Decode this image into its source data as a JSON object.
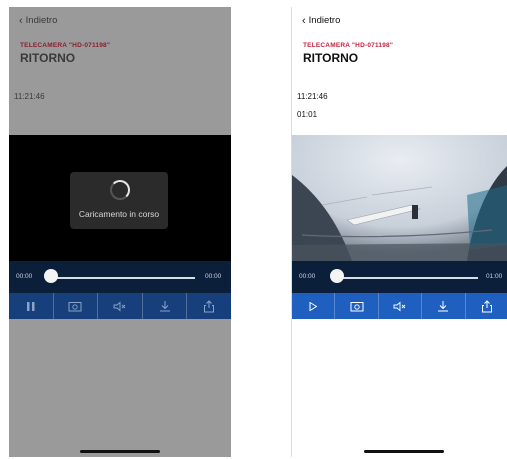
{
  "left": {
    "back_label": "Indietro",
    "camera_label": "TELECAMERA \"HD-071198\"",
    "title": "RITORNO",
    "time": "11:21:46",
    "loading_text": "Caricamento in corso",
    "seek_start": "00:00",
    "seek_end": "00:00",
    "progress": 0,
    "controls": [
      "pause-icon",
      "snapshot-icon",
      "speaker-muted-icon",
      "download-icon",
      "share-icon"
    ]
  },
  "right": {
    "back_label": "Indietro",
    "camera_label": "TELECAMERA \"HD-071198\"",
    "title": "RITORNO",
    "time": "11:21:46",
    "duration": "01:01",
    "seek_start": "00:00",
    "seek_end": "01:00",
    "progress": 0,
    "controls": [
      "play-icon",
      "snapshot-icon",
      "speaker-muted-icon",
      "download-icon",
      "share-icon"
    ]
  },
  "colors": {
    "accent_blue": "#1f5fbf",
    "camera_label_red": "#c0233d",
    "seek_background": "#0b1e3a"
  }
}
